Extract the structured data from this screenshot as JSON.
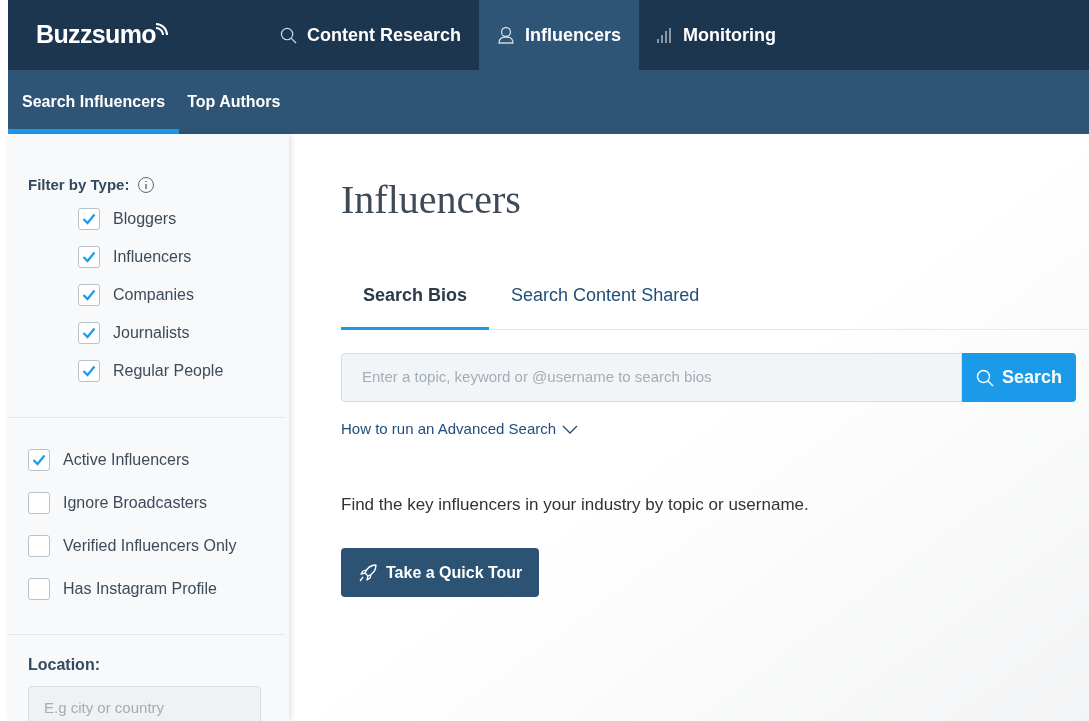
{
  "brand": "Buzzsumo",
  "nav": [
    {
      "label": "Content Research",
      "kind": "search",
      "selected": false
    },
    {
      "label": "Influencers",
      "kind": "person",
      "selected": true
    },
    {
      "label": "Monitoring",
      "kind": "bars",
      "selected": false
    }
  ],
  "subnav": [
    {
      "label": "Search Influencers",
      "selected": true
    },
    {
      "label": "Top Authors",
      "selected": false
    }
  ],
  "sidebar": {
    "filter_title": "Filter by Type:",
    "types": [
      {
        "label": "Bloggers",
        "checked": true
      },
      {
        "label": "Influencers",
        "checked": true
      },
      {
        "label": "Companies",
        "checked": true
      },
      {
        "label": "Journalists",
        "checked": true
      },
      {
        "label": "Regular People",
        "checked": true
      }
    ],
    "options": [
      {
        "label": "Active Influencers",
        "checked": true
      },
      {
        "label": "Ignore Broadcasters",
        "checked": false
      },
      {
        "label": "Verified Influencers Only",
        "checked": false
      },
      {
        "label": "Has Instagram Profile",
        "checked": false
      }
    ],
    "location_title": "Location:",
    "location": {
      "placeholder": "E.g city or country"
    }
  },
  "main": {
    "title": "Influencers",
    "tabs": [
      {
        "label": "Search Bios",
        "selected": true
      },
      {
        "label": "Search Content Shared",
        "selected": false
      }
    ],
    "search": {
      "placeholder": "Enter a topic, keyword or @username to search bios",
      "button": "Search"
    },
    "advanced_link": "How to run an Advanced Search",
    "description": "Find the key influencers in your industry by topic or username.",
    "tour_button": "Take a Quick Tour"
  }
}
